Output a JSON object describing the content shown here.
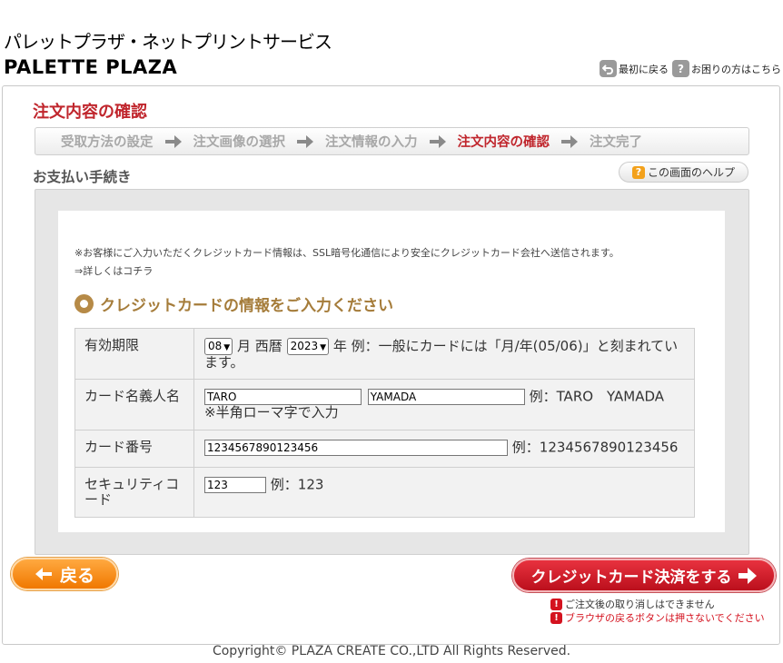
{
  "header": {
    "site_title": "パレットプラザ・ネットプリントサービス",
    "logo_text": "PALETTE PLAZA",
    "links": [
      {
        "label": "最初に戻る",
        "icon": "return-icon"
      },
      {
        "label": "お困りの方はこちら",
        "icon": "question-icon"
      }
    ]
  },
  "page": {
    "title": "注文内容の確認",
    "steps": [
      "受取方法の設定",
      "注文画像の選択",
      "注文情報の入力",
      "注文内容の確認",
      "注文完了"
    ],
    "active_step": "注文内容の確認",
    "subtitle": "お支払い手続き",
    "help_label": "この画面のヘルプ"
  },
  "payment": {
    "notice": "※お客様にご入力いただくクレジットカード情報は、SSL暗号化通信により安全にクレジットカード会社へ送信されます。",
    "notice_link": "⇒詳しくはコチラ",
    "section_title": "クレジットカードの情報をご入力ください",
    "expiry": {
      "label": "有効期限",
      "month": "08",
      "month_unit": "月",
      "era": "西暦",
      "year": "2023",
      "year_unit": "年",
      "hint": "例：一般にカードには「月/年(05/06)」と刻まれています。"
    },
    "name": {
      "label": "カード名義人名",
      "first": "TARO",
      "last": "YAMADA",
      "example": "例：TARO　YAMADA",
      "note": "※半角ローマ字で入力"
    },
    "number": {
      "label": "カード番号",
      "value": "1234567890123456",
      "example": "例：1234567890123456"
    },
    "security": {
      "label": "セキュリティコード",
      "value": "123",
      "example": "例：123"
    }
  },
  "actions": {
    "back_label": "戻る",
    "pay_label": "クレジットカード決済をする",
    "warnings": [
      "ご注文後の取り消しはできません",
      "ブラウザの戻るボタンは押さないでください"
    ]
  },
  "footer": {
    "copyright": "Copyright© PLAZA CREATE CO.,LTD All Rights Reserved."
  },
  "colors": {
    "accent_red": "#c0262d",
    "section_gold": "#a57c3a",
    "back_orange": "#f07800",
    "pay_red": "#bb0f1c"
  }
}
